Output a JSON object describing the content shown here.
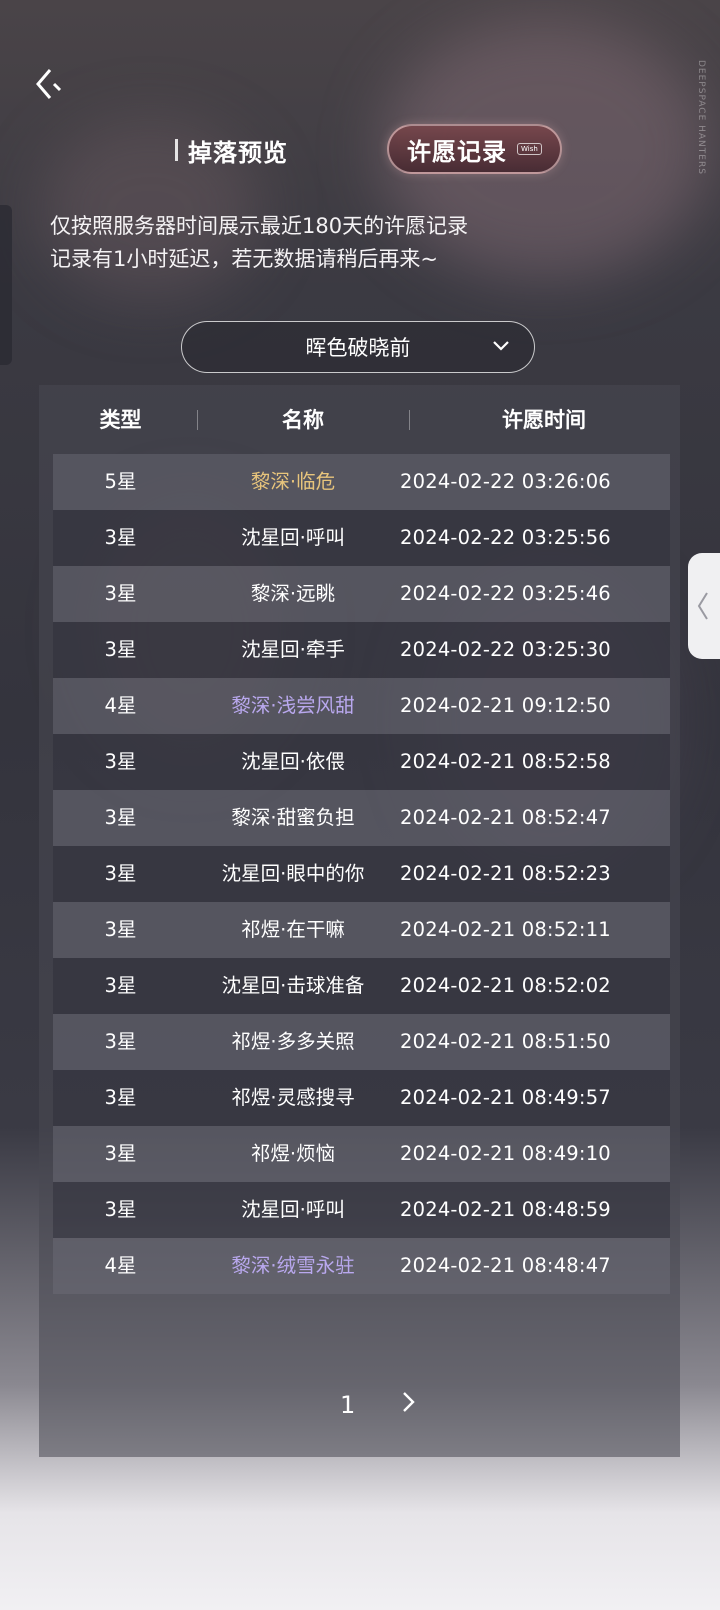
{
  "brand_vertical": "DEEPSPACE HANTERS",
  "tabs": {
    "drop_preview": "掉落预览",
    "wish_record": "许愿记录",
    "wish_record_tag": "Wish"
  },
  "notice": {
    "line1": "仅按照服务器时间展示最近180天的许愿记录",
    "line2": "记录有1小时延迟，若无数据请稍后再来~"
  },
  "pool_select": {
    "value": "晖色破晓前"
  },
  "table": {
    "headers": {
      "type": "类型",
      "name": "名称",
      "time": "许愿时间"
    },
    "rows": [
      {
        "type": "5星",
        "name": "黎深·临危",
        "time": "2024-02-22 03:26:06",
        "rarity": 5
      },
      {
        "type": "3星",
        "name": "沈星回·呼叫",
        "time": "2024-02-22 03:25:56",
        "rarity": 3
      },
      {
        "type": "3星",
        "name": "黎深·远眺",
        "time": "2024-02-22 03:25:46",
        "rarity": 3
      },
      {
        "type": "3星",
        "name": "沈星回·牵手",
        "time": "2024-02-22 03:25:30",
        "rarity": 3
      },
      {
        "type": "4星",
        "name": "黎深·浅尝风甜",
        "time": "2024-02-21 09:12:50",
        "rarity": 4
      },
      {
        "type": "3星",
        "name": "沈星回·依偎",
        "time": "2024-02-21 08:52:58",
        "rarity": 3
      },
      {
        "type": "3星",
        "name": "黎深·甜蜜负担",
        "time": "2024-02-21 08:52:47",
        "rarity": 3
      },
      {
        "type": "3星",
        "name": "沈星回·眼中的你",
        "time": "2024-02-21 08:52:23",
        "rarity": 3
      },
      {
        "type": "3星",
        "name": "祁煜·在干嘛",
        "time": "2024-02-21 08:52:11",
        "rarity": 3
      },
      {
        "type": "3星",
        "name": "沈星回·击球准备",
        "time": "2024-02-21 08:52:02",
        "rarity": 3
      },
      {
        "type": "3星",
        "name": "祁煜·多多关照",
        "time": "2024-02-21 08:51:50",
        "rarity": 3
      },
      {
        "type": "3星",
        "name": "祁煜·灵感搜寻",
        "time": "2024-02-21 08:49:57",
        "rarity": 3
      },
      {
        "type": "3星",
        "name": "祁煜·烦恼",
        "time": "2024-02-21 08:49:10",
        "rarity": 3
      },
      {
        "type": "3星",
        "name": "沈星回·呼叫",
        "time": "2024-02-21 08:48:59",
        "rarity": 3
      },
      {
        "type": "4星",
        "name": "黎深·绒雪永驻",
        "time": "2024-02-21 08:48:47",
        "rarity": 4
      }
    ]
  },
  "pagination": {
    "current": "1"
  },
  "icons": {
    "back": "back-chevron-icon",
    "dropdown": "chevron-down-icon",
    "next": "chevron-right-icon",
    "side": "chevron-left-icon"
  },
  "colors": {
    "five_star": "#e8c57c",
    "four_star": "#b9a8ee",
    "three_star": "#ffffff"
  }
}
